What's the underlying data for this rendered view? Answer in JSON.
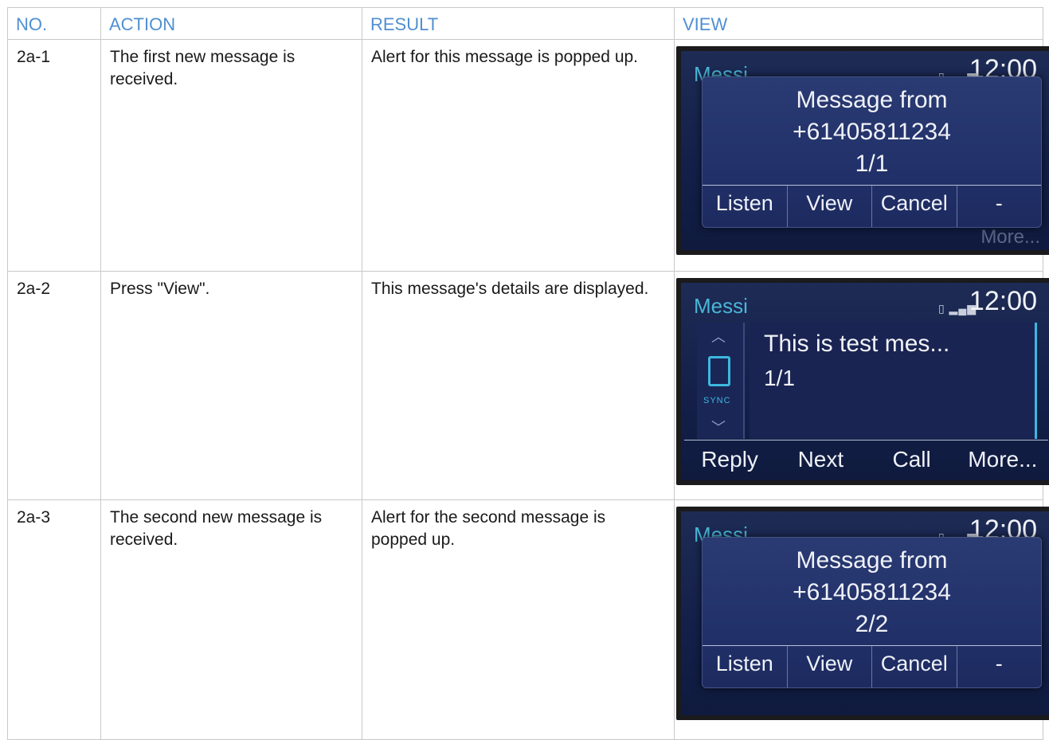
{
  "columns": {
    "no": "NO.",
    "action": "ACTION",
    "result": "RESULT",
    "view": "VIEW"
  },
  "rows": [
    {
      "no": "2a-1",
      "action": "The first new message is received.",
      "result": "Alert for this message is popped up.",
      "screen": {
        "header_left": "Messi",
        "time": "12:00",
        "popup_line1": "Message from",
        "popup_line2": "+61405811234",
        "popup_line3": "1/1",
        "softkeys": [
          "Listen",
          "View",
          "Cancel",
          "-"
        ],
        "ghost": "More..."
      }
    },
    {
      "no": "2a-2",
      "action": "Press \"View\".",
      "result": "This message's details are displayed.",
      "screen": {
        "header_left": "Messi",
        "time": "12:00",
        "message_text": "This is test mes...",
        "message_count": "1/1",
        "brand": "SYNC",
        "softkeys": [
          "Reply",
          "Next",
          "Call",
          "More..."
        ]
      }
    },
    {
      "no": "2a-3",
      "action": "The second new message is received.",
      "result": "Alert for the second message is popped up.",
      "screen": {
        "header_left": "Messi",
        "time": "12:00",
        "popup_line1": "Message from",
        "popup_line2": "+61405811234",
        "popup_line3": "2/2",
        "softkeys": [
          "Listen",
          "View",
          "Cancel",
          "-"
        ]
      }
    }
  ],
  "colors": {
    "header_text": "#4f8fd1",
    "border": "#c8c8c8",
    "screen_accent": "#3cb8e0"
  }
}
